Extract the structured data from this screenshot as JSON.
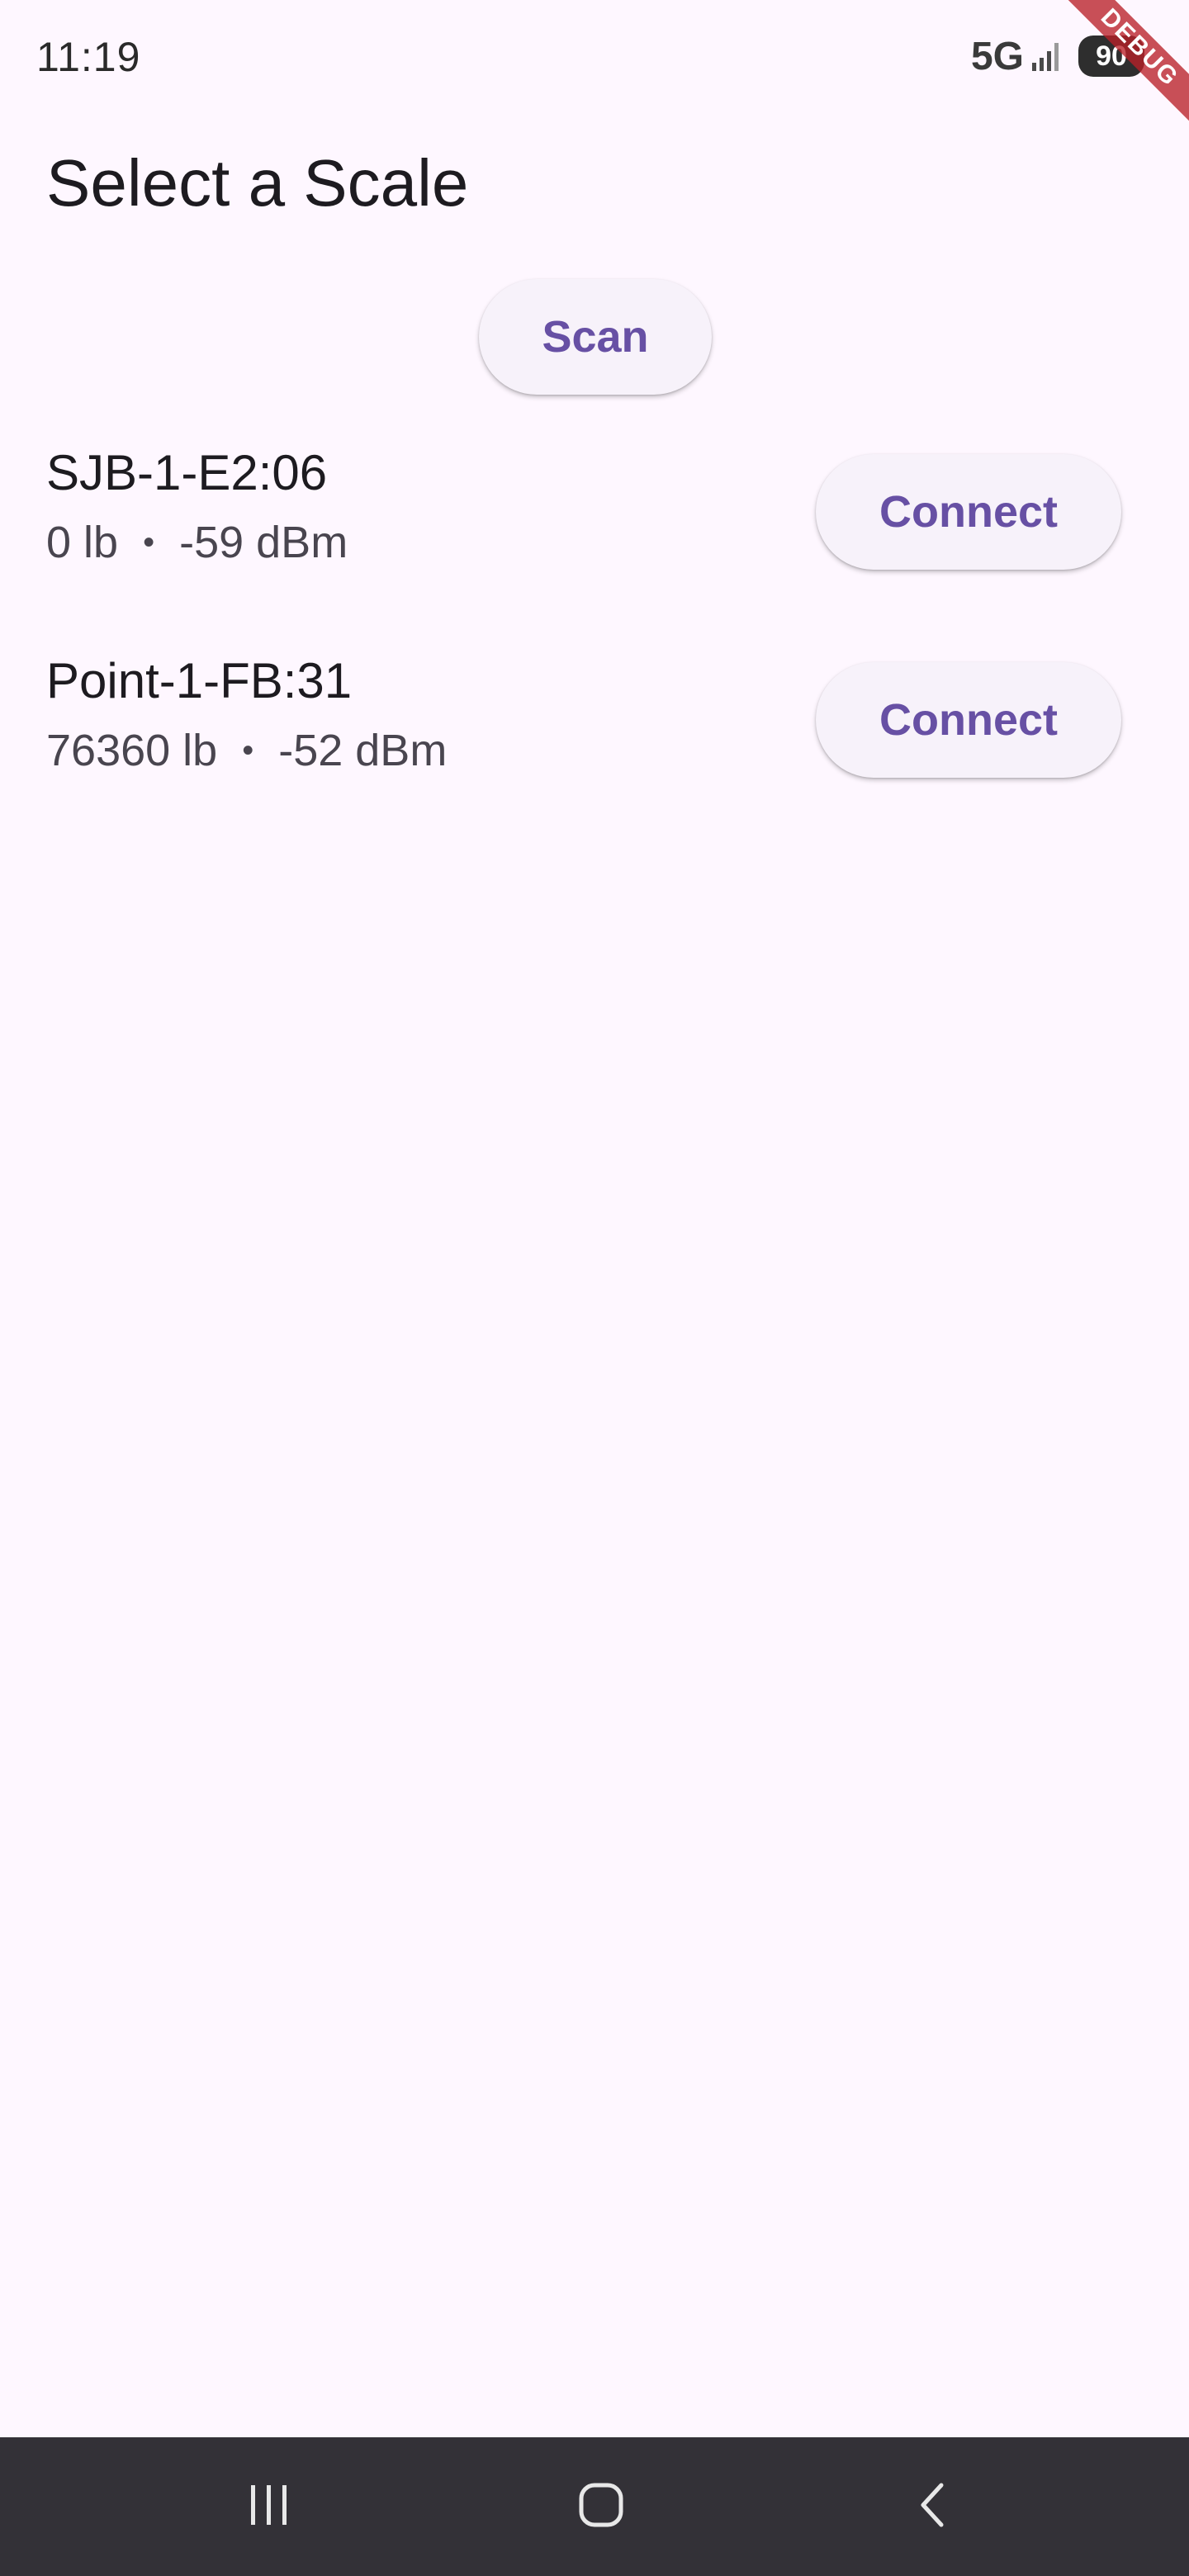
{
  "status_bar": {
    "time": "11:19",
    "network": "5G",
    "battery": "90",
    "debug_banner": "DEBUG"
  },
  "header": {
    "title": "Select a Scale"
  },
  "actions": {
    "scan_label": "Scan"
  },
  "devices": [
    {
      "name": "SJB-1-E2:06",
      "weight": "0 lb",
      "separator": "•",
      "rssi": "-59 dBm",
      "connect_label": "Connect"
    },
    {
      "name": "Point-1-FB:31",
      "weight": "76360 lb",
      "separator": "•",
      "rssi": "-52 dBm",
      "connect_label": "Connect"
    }
  ],
  "theme": {
    "background": "#FEF7FF",
    "accent": "#6750A4",
    "button_surface": "#F7F2FA",
    "nav_bar": "#333137"
  },
  "nav_bar": {
    "icons": [
      "recents-icon",
      "home-icon",
      "back-icon"
    ]
  }
}
